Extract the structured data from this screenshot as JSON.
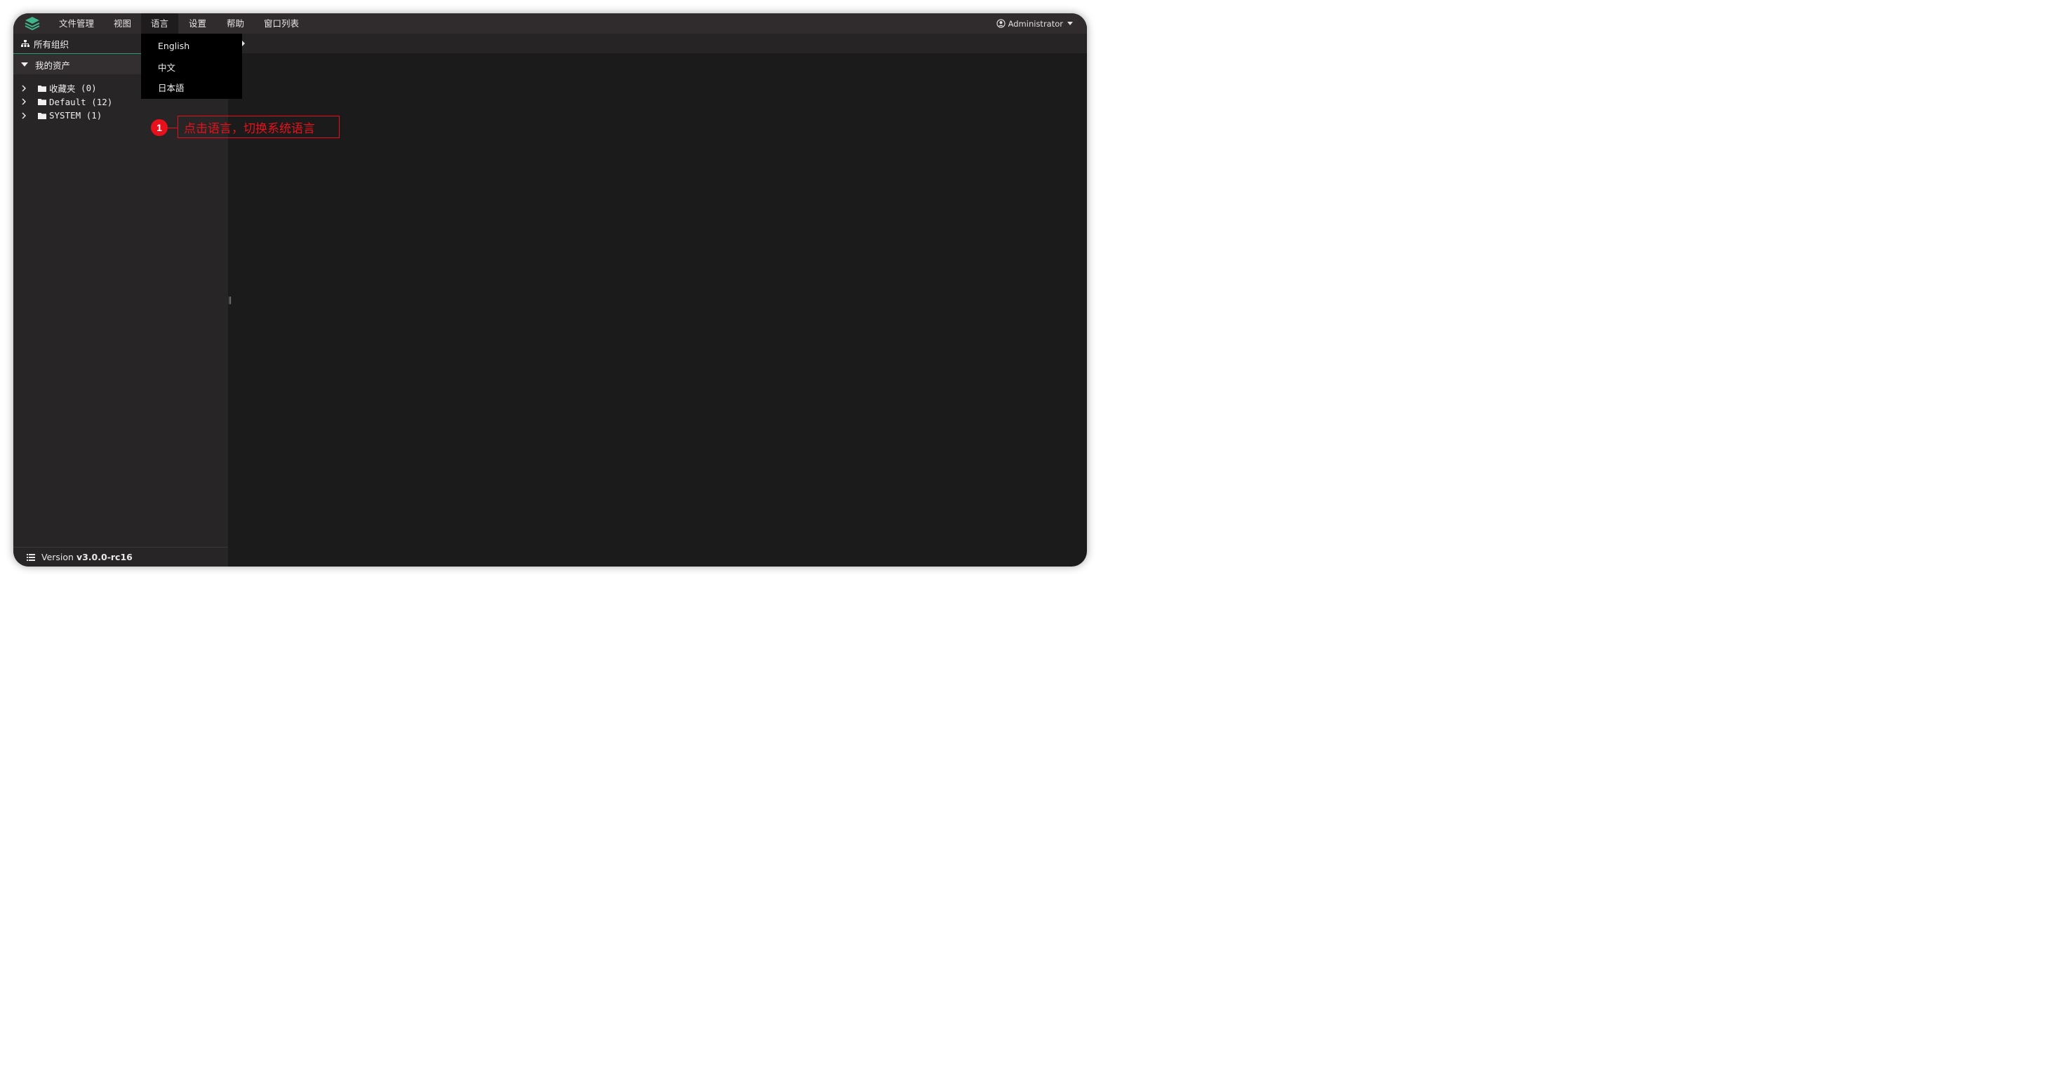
{
  "menubar": {
    "items": [
      "文件管理",
      "视图",
      "语言",
      "设置",
      "帮助",
      "窗口列表"
    ],
    "active_item": "语言",
    "user_label": "Administrator"
  },
  "sidebar": {
    "orgs_label": "所有组织",
    "assets_label": "我的资产",
    "tree": [
      {
        "name": "收藏夹",
        "count": "(0)"
      },
      {
        "name": "Default",
        "count": "(12)"
      },
      {
        "name": "SYSTEM",
        "count": "(1)"
      }
    ],
    "version_prefix": "Version",
    "version_value": "v3.0.0-rc16"
  },
  "language_menu": {
    "options": [
      "English",
      "中文",
      "日本語"
    ]
  },
  "annotation": {
    "number": "1",
    "text": "点击语言，切换系统语言",
    "color": "#e8111b"
  },
  "colors": {
    "accent": "#2f9e78",
    "menubar": "#302b2c",
    "sidebar": "#282526",
    "content": "#1c1b1c"
  }
}
